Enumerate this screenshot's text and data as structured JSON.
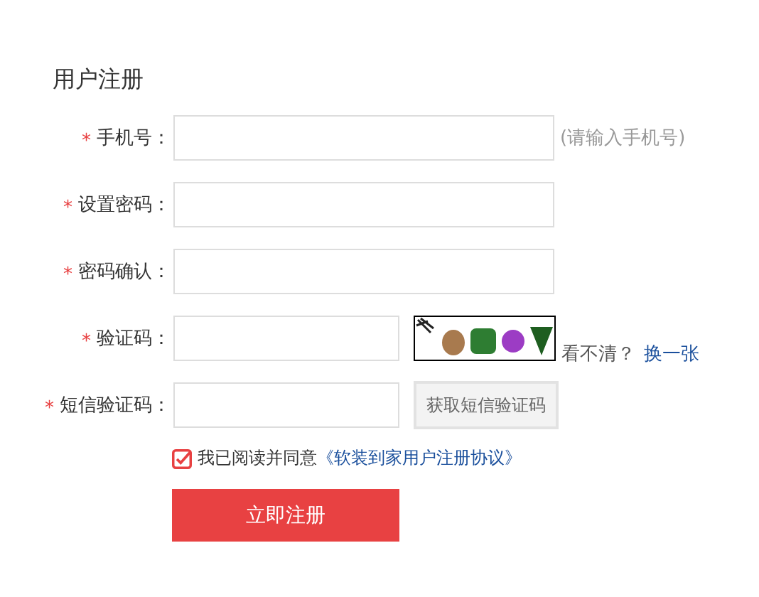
{
  "title": "用户注册",
  "fields": [
    {
      "kind": "text",
      "label": "手机号：",
      "required": true,
      "hint": "(请输入手机号)"
    },
    {
      "kind": "text",
      "label": "设置密码：",
      "required": true
    },
    {
      "kind": "text",
      "label": "密码确认：",
      "required": true
    },
    {
      "kind": "captcha",
      "label": "验证码：",
      "required": true,
      "unclear": "看不清？",
      "refresh_link": "换一张"
    },
    {
      "kind": "sms",
      "label": "短信验证码：",
      "required": true,
      "sms_button": "获取短信验证码"
    }
  ],
  "agreement": {
    "checked": true,
    "text": "我已阅读并同意",
    "link": "《软装到家用户注册协议》"
  },
  "submit": "立即注册",
  "required_mark": "*"
}
